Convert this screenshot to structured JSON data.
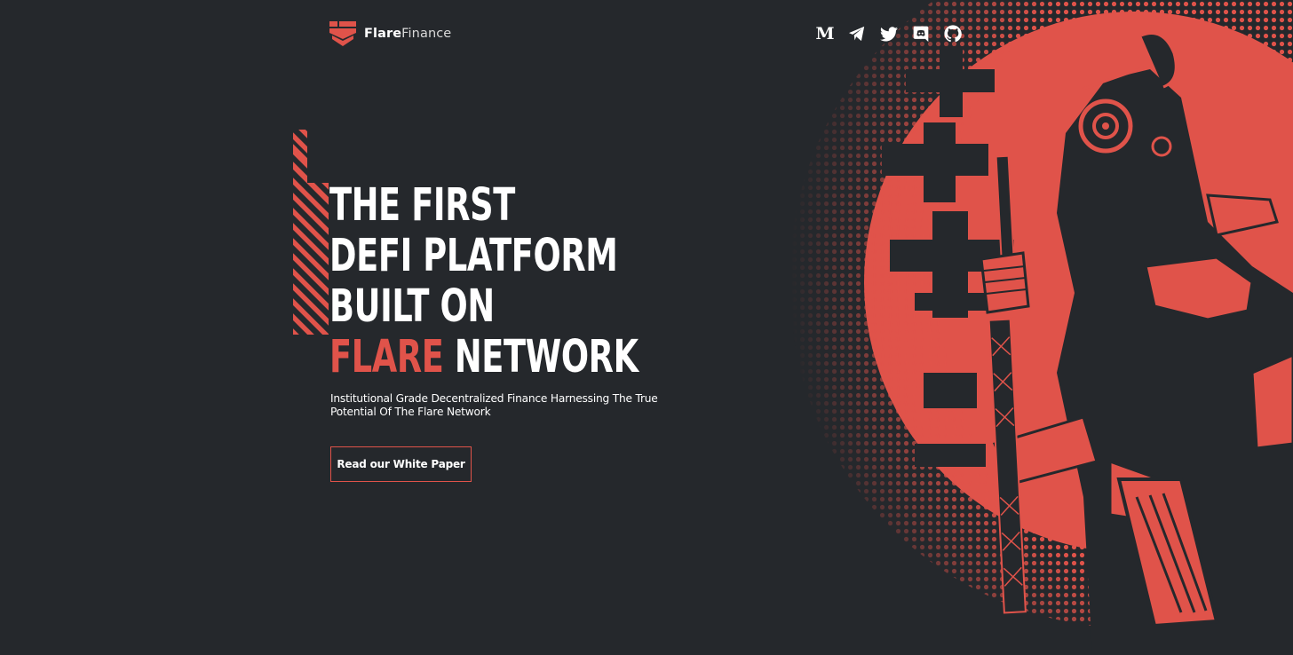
{
  "brand": {
    "name_part1": "Flare",
    "name_part2": "Finance"
  },
  "social_links": [
    {
      "name": "medium",
      "icon": "medium-icon",
      "glyph": "M"
    },
    {
      "name": "telegram",
      "icon": "telegram-icon"
    },
    {
      "name": "twitter",
      "icon": "twitter-icon"
    },
    {
      "name": "discord",
      "icon": "discord-icon"
    },
    {
      "name": "github",
      "icon": "github-icon"
    }
  ],
  "hero": {
    "headline_line1": "THE FIRST",
    "headline_line2": "DEFI PLATFORM",
    "headline_line3": "BUILT ON",
    "headline_accent": "FLARE",
    "headline_line4_rest": " NETWORK",
    "subtitle": "Institutional Grade Decentralized Finance Harnessing The True Potential Of The Flare Network",
    "cta_label": "Read our White Paper"
  },
  "colors": {
    "background": "#25282c",
    "accent": "#e0534a",
    "text": "#ffffff"
  },
  "illustration": {
    "icon": "samurai-illustration"
  }
}
